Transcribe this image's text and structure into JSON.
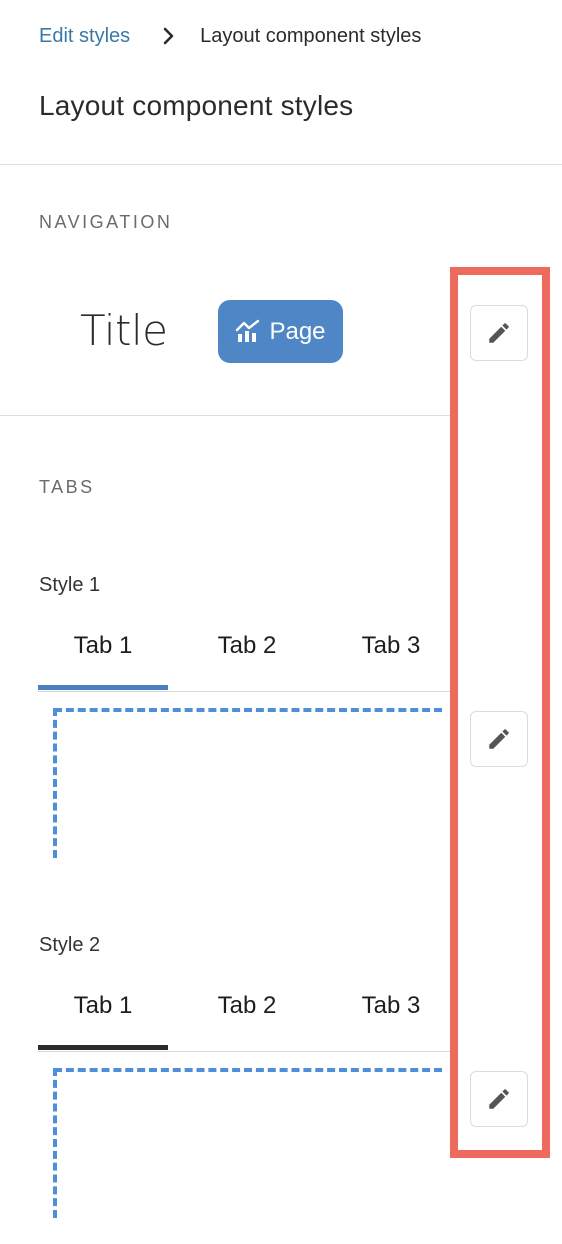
{
  "breadcrumb": {
    "parent_label": "Edit styles",
    "current_label": "Layout component styles"
  },
  "page_title": "Layout component styles",
  "navigation": {
    "section_label": "NAVIGATION",
    "preview_title": "Title",
    "preview_page_label": "Page",
    "edit_icon": "pencil-icon"
  },
  "tabs": {
    "section_label": "TABS",
    "styles": [
      {
        "label": "Style 1",
        "tabs": [
          "Tab 1",
          "Tab 2",
          "Tab 3"
        ],
        "active_index": 0,
        "underline_color": "#4a7fc1"
      },
      {
        "label": "Style 2",
        "tabs": [
          "Tab 1",
          "Tab 2",
          "Tab 3"
        ],
        "active_index": 0,
        "underline_color": "#2b2b2b"
      }
    ]
  },
  "colors": {
    "link": "#3a78a8",
    "accent": "#4e86c6",
    "highlight": "#ee6a5c",
    "dashed_outline": "#4f8fd9"
  }
}
